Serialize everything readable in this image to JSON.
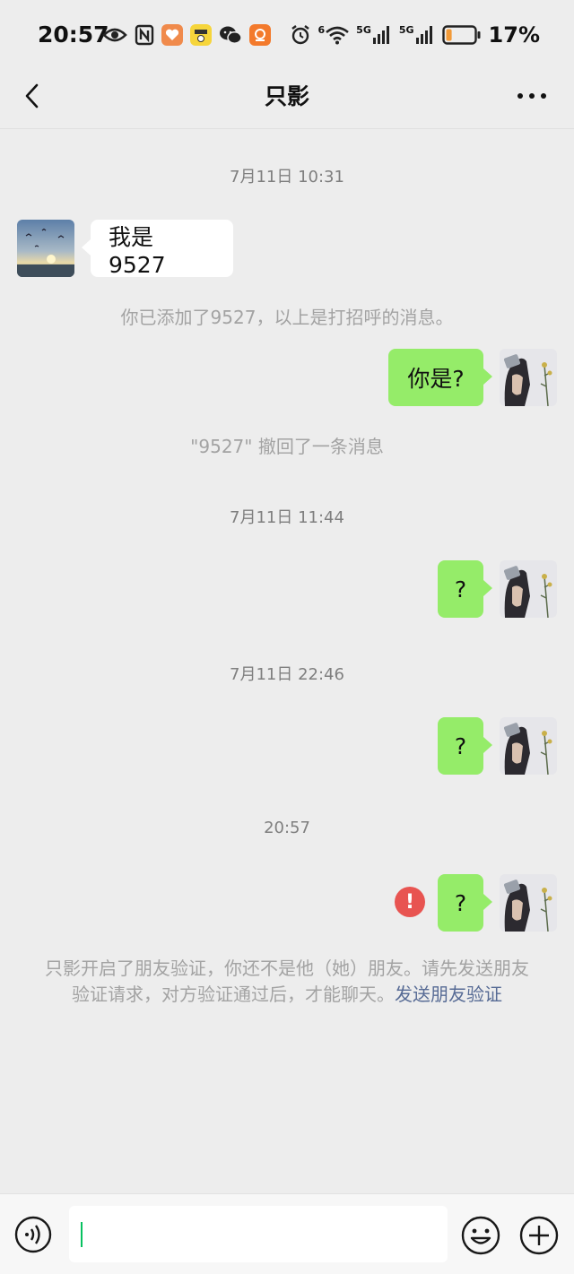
{
  "status_bar": {
    "time": "20:57",
    "battery_percent": "17%",
    "network_1": "5G",
    "network_2": "5G",
    "wifi_label": "6",
    "battery_level": 0.17
  },
  "header": {
    "title": "只影"
  },
  "messages": {
    "time_1": "7月11日 10:31",
    "incoming_1": "我是 9527",
    "system_added": "你已添加了9527，以上是打招呼的消息。",
    "outgoing_1": "你是?",
    "system_recalled": "\"9527\" 撤回了一条消息",
    "time_2": "7月11日 11:44",
    "outgoing_2": "?",
    "time_3": "7月11日 22:46",
    "outgoing_3": "?",
    "time_4": "20:57",
    "outgoing_4": "?",
    "error_mark": "!"
  },
  "notice": {
    "text": "只影开启了朋友验证，你还不是他（她）朋友。请先发送朋友验证请求，对方验证通过后，才能聊天。",
    "link": "发送朋友验证"
  },
  "input": {
    "value": ""
  },
  "colors": {
    "background": "#ededed",
    "bubble_out": "#95ec69",
    "bubble_in": "#ffffff",
    "link": "#576b95",
    "error": "#e85451",
    "caret": "#07c160"
  }
}
